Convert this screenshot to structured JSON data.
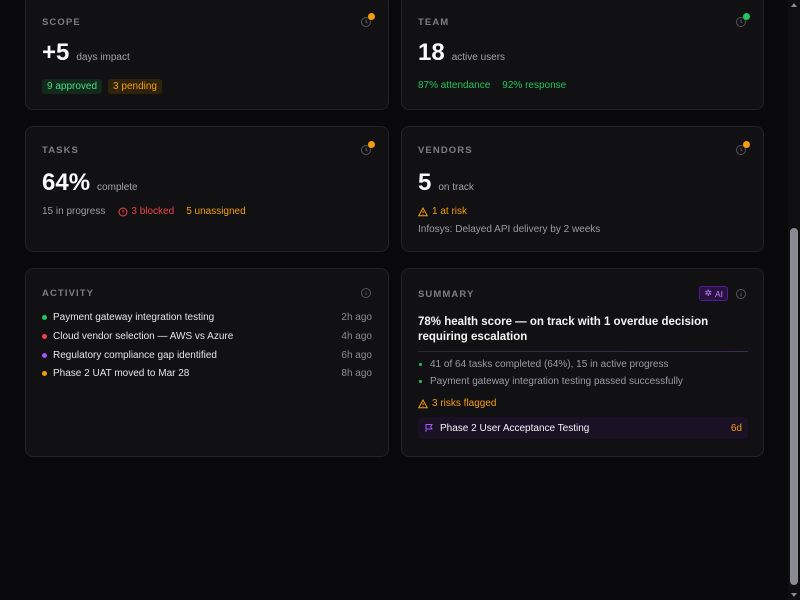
{
  "colors": {
    "green": "#22c55e",
    "amber": "#f59e0b",
    "red": "#ef4444",
    "purple": "#a855f7"
  },
  "scope": {
    "title": "SCOPE",
    "value": "+5",
    "suffix": "days impact",
    "approved": "9 approved",
    "pending": "3 pending",
    "status_color": "amber"
  },
  "team": {
    "title": "TEAM",
    "value": "18",
    "suffix": "active users",
    "attendance": "87% attendance",
    "response": "92% response",
    "status_color": "green"
  },
  "tasks": {
    "title": "TASKS",
    "value": "64%",
    "suffix": "complete",
    "in_progress": "15 in progress",
    "blocked": "3 blocked",
    "unassigned": "5 unassigned",
    "status_color": "amber"
  },
  "vendors": {
    "title": "VENDORS",
    "value": "5",
    "suffix": "on track",
    "at_risk": "1 at risk",
    "note": "Infosys: Delayed API delivery by 2 weeks",
    "status_color": "amber"
  },
  "activity": {
    "title": "ACTIVITY",
    "items": [
      {
        "text": "Payment gateway integration testing",
        "time": "2h ago",
        "color": "green"
      },
      {
        "text": "Cloud vendor selection — AWS vs Azure",
        "time": "4h ago",
        "color": "red"
      },
      {
        "text": "Regulatory compliance gap identified",
        "time": "6h ago",
        "color": "purple"
      },
      {
        "text": "Phase 2 UAT moved to Mar 28",
        "time": "8h ago",
        "color": "amber"
      }
    ]
  },
  "summary": {
    "title": "SUMMARY",
    "ai_badge": "AI",
    "headline": "78% health score — on track with 1 overdue decision requiring escalation",
    "bullets": [
      "41 of 64 tasks completed (64%), 15 in active progress",
      "Payment gateway integration testing passed successfully"
    ],
    "risks": "3 risks flagged",
    "milestone": {
      "label": "Phase 2 User Acceptance Testing",
      "due": "6d"
    }
  }
}
